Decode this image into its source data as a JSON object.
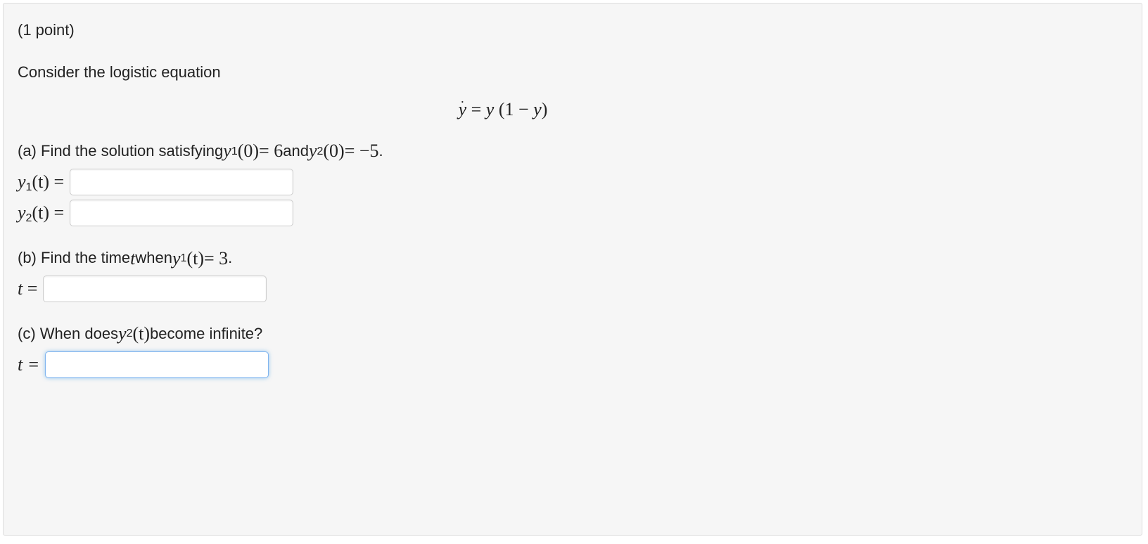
{
  "points_label": "(1 point)",
  "intro": "Consider the logistic equation",
  "equation": "ẏ = y (1 − y)",
  "part_a": {
    "prefix": "(a) Find the solution satisfying ",
    "cond1_var": "y",
    "cond1_sub": "1",
    "cond1_arg": "(0)",
    "cond1_eq": " = 6",
    "between": " and ",
    "cond2_var": "y",
    "cond2_sub": "2",
    "cond2_arg": "(0)",
    "cond2_eq": " = −5",
    "suffix": ".",
    "y1_label_var": "y",
    "y1_label_sub": "1",
    "y1_label_arg": "(t)",
    "y1_label_eq": " =",
    "y2_label_var": "y",
    "y2_label_sub": "2",
    "y2_label_arg": "(t)",
    "y2_label_eq": " =",
    "y1_value": "",
    "y2_value": ""
  },
  "part_b": {
    "prefix": "(b) Find the time ",
    "tvar": "t",
    "mid": " when ",
    "yvar": "y",
    "ysub": "1",
    "yarg": "(t)",
    "yeq": " = 3",
    "suffix": ".",
    "t_label_var": "t",
    "t_label_eq": " =",
    "t_value": ""
  },
  "part_c": {
    "prefix": "(c) When does ",
    "yvar": "y",
    "ysub": "2",
    "yarg": "(t)",
    "suffix": " become infinite?",
    "t_label": "t =",
    "t_value": ""
  }
}
